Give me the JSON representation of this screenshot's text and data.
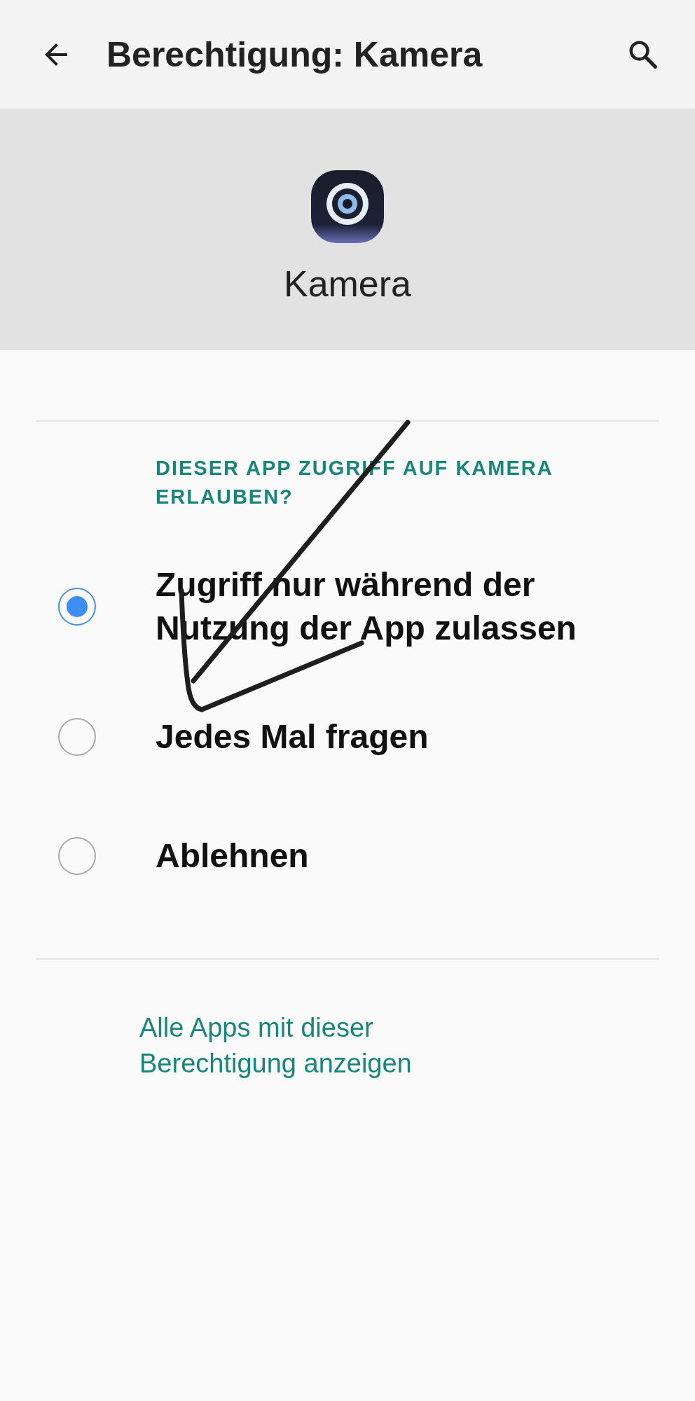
{
  "top_bar": {
    "title": "Berechtigung: Kamera"
  },
  "app": {
    "name": "Kamera"
  },
  "section": {
    "heading": "DIESER APP ZUGRIFF AUF KAMERA ERLAUBEN?"
  },
  "options": [
    {
      "label": "Zugriff nur während der Nutzung der App zulassen",
      "selected": true
    },
    {
      "label": "Jedes Mal fragen",
      "selected": false
    },
    {
      "label": "Ablehnen",
      "selected": false
    }
  ],
  "link": "Alle Apps mit dieser Berechtigung anzeigen"
}
